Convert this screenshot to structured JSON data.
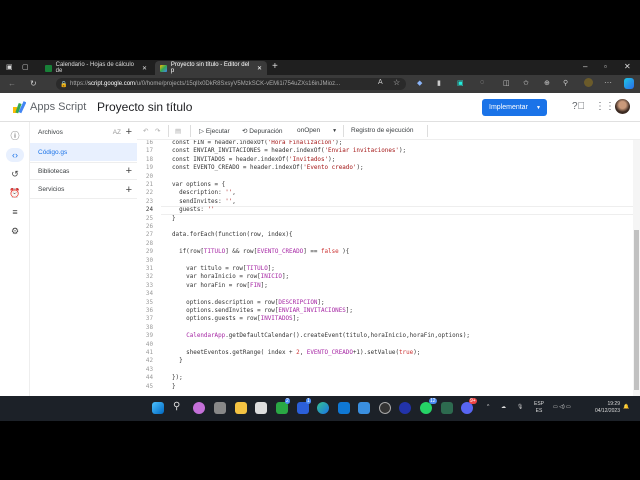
{
  "browser": {
    "tabs": [
      {
        "label": "Calendario - Hojas de cálculo de",
        "active": false
      },
      {
        "label": "Proyecto sin título - Editor del p",
        "active": true
      }
    ],
    "url_prefix": "https://",
    "url_host": "script.google.com",
    "url_path": "/u/0/home/projects/15qlIx0DkR8SxsyV5MzkSCK-vEMi1i754uZXs16inJMioz..."
  },
  "app": {
    "name": "Apps Script",
    "project_title": "Proyecto sin título",
    "deploy_label": "Implementar",
    "brand_color": "#1a73e8"
  },
  "files": {
    "header": "Archivos",
    "sort_label": "AZ",
    "items": [
      {
        "label": "Código.gs",
        "selected": true
      }
    ],
    "libraries": "Bibliotecas",
    "services": "Servicios"
  },
  "toolbar": {
    "run": "Ejecutar",
    "debug": "Depuración",
    "function": "onOpen",
    "log": "Registro de ejecución"
  },
  "editor": {
    "current_line": 24,
    "lines": [
      {
        "n": 16,
        "t": [
          [
            "p",
            "const FIN = header.indexOf("
          ],
          [
            "s",
            "'Hora Finalizacion'"
          ],
          [
            "p",
            ");"
          ]
        ]
      },
      {
        "n": 17,
        "t": [
          [
            "p",
            "const ENVIAR_INVITACIONES = header.indexOf("
          ],
          [
            "s",
            "'Enviar invitaciones'"
          ],
          [
            "p",
            ");"
          ]
        ]
      },
      {
        "n": 18,
        "t": [
          [
            "p",
            "const INVITADOS = header.indexOf("
          ],
          [
            "s",
            "'Invitados'"
          ],
          [
            "p",
            ");"
          ]
        ]
      },
      {
        "n": 19,
        "t": [
          [
            "p",
            "const EVENTO_CREADO = header.indexOf("
          ],
          [
            "s",
            "'Evento creado'"
          ],
          [
            "p",
            ");"
          ]
        ]
      },
      {
        "n": 20,
        "t": []
      },
      {
        "n": 21,
        "t": [
          [
            "p",
            "var options = {"
          ]
        ]
      },
      {
        "n": 22,
        "t": [
          [
            "p",
            "  description: "
          ],
          [
            "s",
            "''"
          ],
          [
            "p",
            ","
          ]
        ]
      },
      {
        "n": 23,
        "t": [
          [
            "p",
            "  sendInvites: "
          ],
          [
            "s",
            "''"
          ],
          [
            "p",
            ","
          ]
        ]
      },
      {
        "n": 24,
        "t": [
          [
            "p",
            "  guests: "
          ],
          [
            "s",
            "''"
          ]
        ]
      },
      {
        "n": 25,
        "t": [
          [
            "p",
            "}"
          ]
        ]
      },
      {
        "n": 26,
        "t": []
      },
      {
        "n": 27,
        "t": [
          [
            "p",
            "data.forEach(function(row, index){"
          ]
        ]
      },
      {
        "n": 28,
        "t": []
      },
      {
        "n": 29,
        "t": [
          [
            "p",
            "  if(row["
          ],
          [
            "c",
            "TITULO"
          ],
          [
            "p",
            "] && row["
          ],
          [
            "c",
            "EVENTO_CREADO"
          ],
          [
            "p",
            "] == "
          ],
          [
            "b",
            "false"
          ],
          [
            "p",
            " ){"
          ]
        ]
      },
      {
        "n": 30,
        "t": []
      },
      {
        "n": 31,
        "t": [
          [
            "p",
            "    var titulo = row["
          ],
          [
            "c",
            "TITULO"
          ],
          [
            "p",
            "];"
          ]
        ]
      },
      {
        "n": 32,
        "t": [
          [
            "p",
            "    var horaInicio = row["
          ],
          [
            "c",
            "INICIO"
          ],
          [
            "p",
            "];"
          ]
        ]
      },
      {
        "n": 33,
        "t": [
          [
            "p",
            "    var horaFin = row["
          ],
          [
            "c",
            "FIN"
          ],
          [
            "p",
            "];"
          ]
        ]
      },
      {
        "n": 34,
        "t": []
      },
      {
        "n": 35,
        "t": [
          [
            "p",
            "    options.description = row["
          ],
          [
            "c",
            "DESCRIPCION"
          ],
          [
            "p",
            "];"
          ]
        ]
      },
      {
        "n": 36,
        "t": [
          [
            "p",
            "    options.sendInvites = row["
          ],
          [
            "c",
            "ENVIAR_INVITACIONES"
          ],
          [
            "p",
            "];"
          ]
        ]
      },
      {
        "n": 37,
        "t": [
          [
            "p",
            "    options.guests = row["
          ],
          [
            "c",
            "INVITADOS"
          ],
          [
            "p",
            "];"
          ]
        ]
      },
      {
        "n": 38,
        "t": []
      },
      {
        "n": 39,
        "t": [
          [
            "p",
            "    "
          ],
          [
            "c",
            "CalendarApp"
          ],
          [
            "p",
            ".getDefaultCalendar().createEvent(titulo,horaInicio,horaFin,options);"
          ]
        ]
      },
      {
        "n": 40,
        "t": []
      },
      {
        "n": 41,
        "t": [
          [
            "p",
            "    sheetEventos.getRange( index + "
          ],
          [
            "n",
            "2"
          ],
          [
            "p",
            ", "
          ],
          [
            "c",
            "EVENTO_CREADO"
          ],
          [
            "p",
            "+1).setValue("
          ],
          [
            "b",
            "true"
          ],
          [
            "p",
            ");"
          ]
        ]
      },
      {
        "n": 42,
        "t": [
          [
            "p",
            "  }"
          ]
        ]
      },
      {
        "n": 43,
        "t": []
      },
      {
        "n": 44,
        "t": [
          [
            "p",
            "});"
          ]
        ]
      },
      {
        "n": 45,
        "t": [
          [
            "p",
            "}"
          ]
        ]
      }
    ]
  },
  "taskbar": {
    "lang": "ESP",
    "lang_sub": "ES",
    "time": "19:29",
    "date": "04/12/2023",
    "badges": [
      "2",
      "1",
      "12",
      "9+"
    ]
  }
}
